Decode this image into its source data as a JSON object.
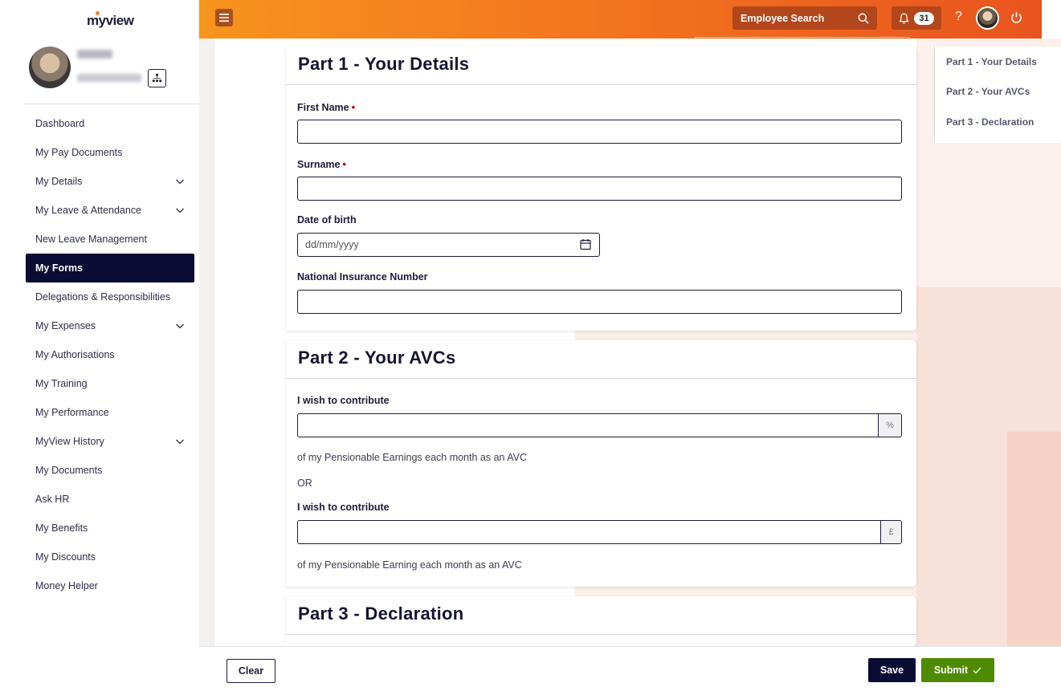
{
  "app": {
    "logo_my": "my",
    "logo_view": "view"
  },
  "sidebar": {
    "items": [
      {
        "label": "Dashboard",
        "chevron": false,
        "active": false
      },
      {
        "label": "My Pay Documents",
        "chevron": false,
        "active": false
      },
      {
        "label": "My Details",
        "chevron": true,
        "active": false
      },
      {
        "label": "My Leave & Attendance",
        "chevron": true,
        "active": false
      },
      {
        "label": "New Leave Management",
        "chevron": false,
        "active": false
      },
      {
        "label": "My Forms",
        "chevron": false,
        "active": true
      },
      {
        "label": "Delegations & Responsibilities",
        "chevron": false,
        "active": false
      },
      {
        "label": "My Expenses",
        "chevron": true,
        "active": false
      },
      {
        "label": "My Authorisations",
        "chevron": false,
        "active": false
      },
      {
        "label": "My Training",
        "chevron": false,
        "active": false
      },
      {
        "label": "My Performance",
        "chevron": false,
        "active": false
      },
      {
        "label": "MyView History",
        "chevron": true,
        "active": false
      },
      {
        "label": "My Documents",
        "chevron": false,
        "active": false
      },
      {
        "label": "Ask HR",
        "chevron": false,
        "active": false
      },
      {
        "label": "My Benefits",
        "chevron": false,
        "active": false
      },
      {
        "label": "My Discounts",
        "chevron": false,
        "active": false
      },
      {
        "label": "Money Helper",
        "chevron": false,
        "active": false
      }
    ]
  },
  "header": {
    "search_label": "Employee Search",
    "notification_count": "31",
    "help_label": "?"
  },
  "right_nav": {
    "items": [
      "Part 1 - Your Details",
      "Part 2 - Your AVCs",
      "Part 3 - Declaration"
    ]
  },
  "part1": {
    "title": "Part 1 - Your Details",
    "first_name_label": "First Name",
    "surname_label": "Surname",
    "dob_label": "Date of birth",
    "dob_placeholder": "dd/mm/yyyy",
    "ni_label": "National Insurance Number",
    "required_mark": "•"
  },
  "part2": {
    "title": "Part 2 - Your AVCs",
    "contribute_label_1": "I wish to contribute",
    "percent_addon": "%",
    "note_1": "of my Pensionable Earnings each month as an AVC",
    "or_text": "OR",
    "contribute_label_2": "I wish to contribute",
    "pound_addon": "£",
    "note_2": "of my Pensionable Earning each month as an AVC"
  },
  "part3": {
    "title": "Part 3 - Declaration"
  },
  "footer": {
    "clear_label": "Clear",
    "save_label": "Save",
    "submit_label": "Submit"
  },
  "colors": {
    "header_start": "#f7941d",
    "header_end": "#e8541e",
    "nav_active": "#0b0c33",
    "submit_green": "#4e8b00",
    "required_red": "#d40000"
  }
}
